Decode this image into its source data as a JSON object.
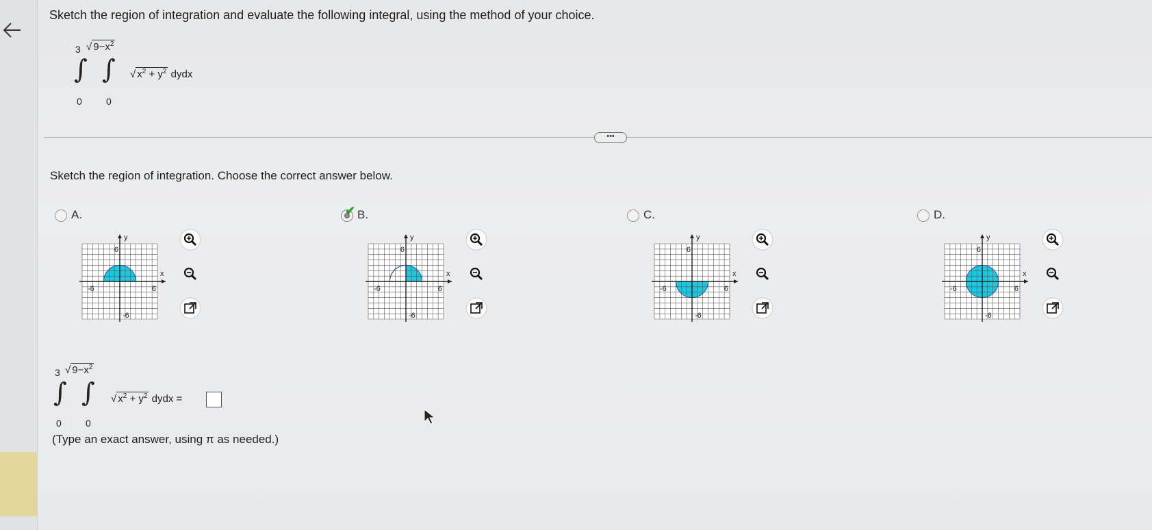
{
  "question": "Sketch the region of integration and evaluate the following integral, using the method of your choice.",
  "integral": {
    "outer_upper": "3",
    "outer_lower": "0",
    "inner_upper_radicand": "9−x",
    "inner_upper_exp": "2",
    "inner_lower": "0",
    "integrand_x": "x",
    "integrand_y": "y",
    "exp": "2",
    "plus": "+",
    "differential": "dydx"
  },
  "more_button": "•••",
  "prompt": "Sketch the region of integration. Choose the correct answer below.",
  "choices": [
    {
      "label": "A.",
      "selected": false,
      "region": "upper-half-disk"
    },
    {
      "label": "B.",
      "selected": true,
      "region": "first-quadrant-quarter-disk"
    },
    {
      "label": "C.",
      "selected": false,
      "region": "lower-half-disk"
    },
    {
      "label": "D.",
      "selected": false,
      "region": "full-disk"
    }
  ],
  "graph_labels": {
    "y": "y",
    "x": "x",
    "tick_pos": "6",
    "tick_neg": "-6"
  },
  "tools": [
    "zoom-in-icon",
    "zoom-out-icon",
    "open-external-icon"
  ],
  "answer": {
    "equals": "=",
    "value": "",
    "hint": "(Type an exact answer, using π as needed.)"
  },
  "colors": {
    "fill": "#1ec8e0",
    "grid": "#555555",
    "check": "#2d9a2d"
  }
}
